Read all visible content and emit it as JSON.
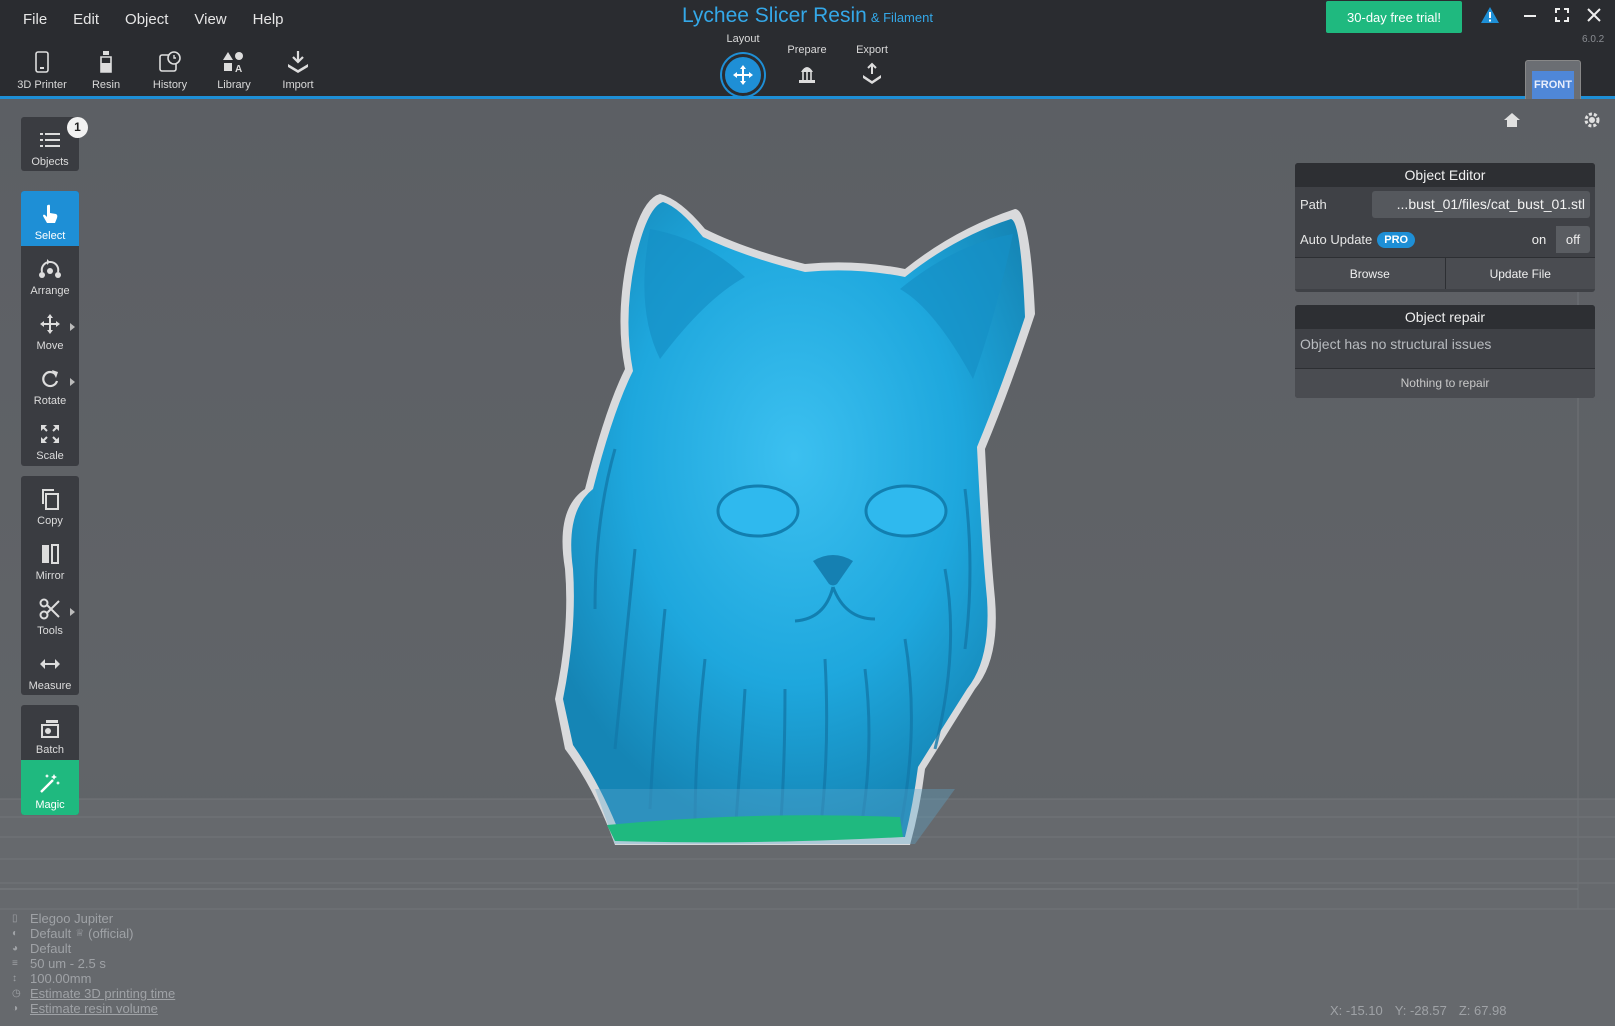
{
  "menu": [
    "File",
    "Edit",
    "Object",
    "View",
    "Help"
  ],
  "app": {
    "title": "Lychee Slicer Resin",
    "subtitle": "& Filament",
    "version": "6.0.2"
  },
  "trial_button": "30-day free trial!",
  "top_tools": [
    {
      "label": "3D Printer",
      "icon": "printer-icon"
    },
    {
      "label": "Resin",
      "icon": "resin-bottle-icon"
    },
    {
      "label": "History",
      "icon": "history-icon"
    },
    {
      "label": "Library",
      "icon": "library-icon"
    },
    {
      "label": "Import",
      "icon": "import-icon"
    }
  ],
  "modes": {
    "layout": "Layout",
    "prepare": "Prepare",
    "export": "Export",
    "active": "Layout"
  },
  "view_cube": "FRONT",
  "left_tools": {
    "objects": "Objects",
    "objects_count": "1",
    "select": "Select",
    "arrange": "Arrange",
    "move": "Move",
    "rotate": "Rotate",
    "scale": "Scale",
    "copy": "Copy",
    "mirror": "Mirror",
    "tools": "Tools",
    "measure": "Measure",
    "batch": "Batch",
    "magic": "Magic"
  },
  "object_editor": {
    "title": "Object Editor",
    "path_label": "Path",
    "path_value": "...bust_01/files/cat_bust_01.stl",
    "auto_update_label": "Auto Update",
    "pro_badge": "PRO",
    "toggle_on": "on",
    "toggle_off": "off",
    "toggle_state": "off",
    "browse": "Browse",
    "update_file": "Update File"
  },
  "object_repair": {
    "title": "Object repair",
    "message": "Object has no structural issues",
    "button": "Nothing to repair"
  },
  "info": {
    "printer": "Elegoo Jupiter",
    "resin": "Default",
    "resin_suffix": "(official)",
    "profile": "Default",
    "layer": "50 um - 2.5 s",
    "height": "100.00mm",
    "estimate_time": "Estimate 3D printing time",
    "estimate_volume": "Estimate resin volume"
  },
  "coords": {
    "x": "X: -15.10",
    "y": "Y: -28.57",
    "z": "Z: 67.98"
  },
  "colors": {
    "accent": "#1e8fd6",
    "trial": "#1fb97f",
    "model": "#1ea7dd",
    "base": "#1fb97f"
  }
}
